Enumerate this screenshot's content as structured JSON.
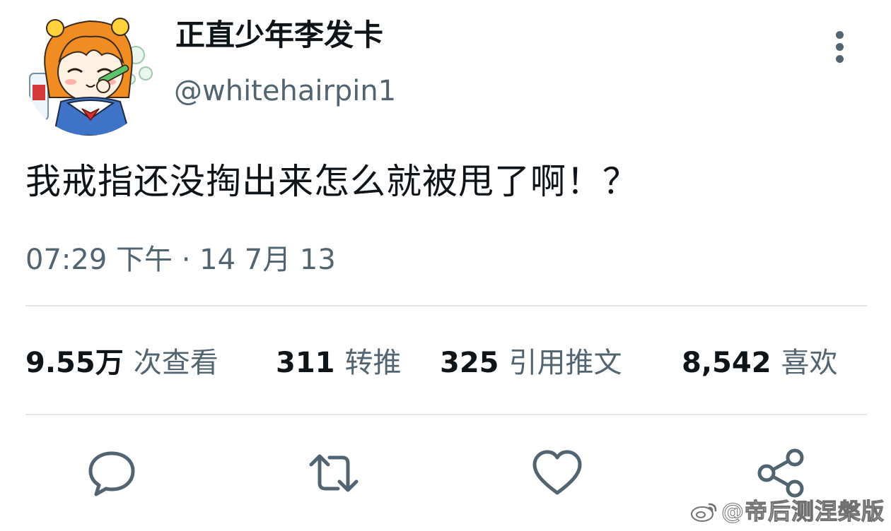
{
  "author": {
    "display_name": "正直少年李发卡",
    "handle": "@whitehairpin1",
    "avatar": "anime-girl-avatar"
  },
  "tweet": {
    "text": "我戒指还没掏出来怎么就被甩了啊！？",
    "timestamp": "07:29 下午 · 14 7月 13"
  },
  "stats": {
    "views_count": "9.55万",
    "views_label": "次查看",
    "retweets_count": "311",
    "retweets_label": "转推",
    "quotes_count": "325",
    "quotes_label": "引用推文",
    "likes_count": "8,542",
    "likes_label": "喜欢"
  },
  "actions": {
    "reply_icon": "speech-bubble-icon",
    "retweet_icon": "retweet-arrows-icon",
    "like_icon": "heart-icon",
    "share_icon": "share-nodes-icon"
  },
  "menu": {
    "icon": "more-vertical-icon"
  },
  "watermark": {
    "text": "@帝后测涅槃版"
  },
  "colors": {
    "text_primary": "#0f1419",
    "text_secondary": "#536471",
    "divider": "#e3e6e9",
    "icon": "#536471",
    "background": "#ffffff"
  }
}
